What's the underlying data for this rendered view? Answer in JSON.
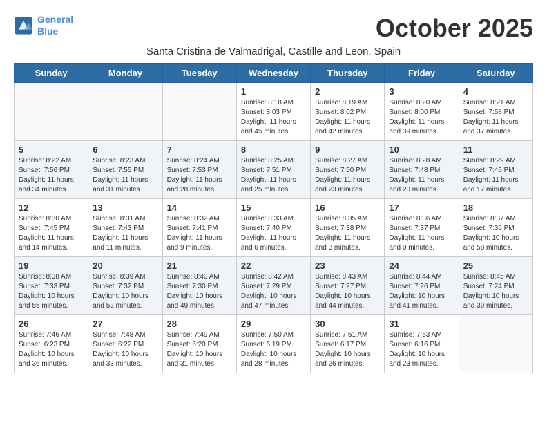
{
  "header": {
    "logo_line1": "General",
    "logo_line2": "Blue",
    "month_title": "October 2025",
    "location": "Santa Cristina de Valmadrigal, Castille and Leon, Spain"
  },
  "weekdays": [
    "Sunday",
    "Monday",
    "Tuesday",
    "Wednesday",
    "Thursday",
    "Friday",
    "Saturday"
  ],
  "weeks": [
    [
      {
        "day": "",
        "info": ""
      },
      {
        "day": "",
        "info": ""
      },
      {
        "day": "",
        "info": ""
      },
      {
        "day": "1",
        "info": "Sunrise: 8:18 AM\nSunset: 8:03 PM\nDaylight: 11 hours\nand 45 minutes."
      },
      {
        "day": "2",
        "info": "Sunrise: 8:19 AM\nSunset: 8:02 PM\nDaylight: 11 hours\nand 42 minutes."
      },
      {
        "day": "3",
        "info": "Sunrise: 8:20 AM\nSunset: 8:00 PM\nDaylight: 11 hours\nand 39 minutes."
      },
      {
        "day": "4",
        "info": "Sunrise: 8:21 AM\nSunset: 7:58 PM\nDaylight: 11 hours\nand 37 minutes."
      }
    ],
    [
      {
        "day": "5",
        "info": "Sunrise: 8:22 AM\nSunset: 7:56 PM\nDaylight: 11 hours\nand 34 minutes."
      },
      {
        "day": "6",
        "info": "Sunrise: 8:23 AM\nSunset: 7:55 PM\nDaylight: 11 hours\nand 31 minutes."
      },
      {
        "day": "7",
        "info": "Sunrise: 8:24 AM\nSunset: 7:53 PM\nDaylight: 11 hours\nand 28 minutes."
      },
      {
        "day": "8",
        "info": "Sunrise: 8:25 AM\nSunset: 7:51 PM\nDaylight: 11 hours\nand 25 minutes."
      },
      {
        "day": "9",
        "info": "Sunrise: 8:27 AM\nSunset: 7:50 PM\nDaylight: 11 hours\nand 23 minutes."
      },
      {
        "day": "10",
        "info": "Sunrise: 8:28 AM\nSunset: 7:48 PM\nDaylight: 11 hours\nand 20 minutes."
      },
      {
        "day": "11",
        "info": "Sunrise: 8:29 AM\nSunset: 7:46 PM\nDaylight: 11 hours\nand 17 minutes."
      }
    ],
    [
      {
        "day": "12",
        "info": "Sunrise: 8:30 AM\nSunset: 7:45 PM\nDaylight: 11 hours\nand 14 minutes."
      },
      {
        "day": "13",
        "info": "Sunrise: 8:31 AM\nSunset: 7:43 PM\nDaylight: 11 hours\nand 11 minutes."
      },
      {
        "day": "14",
        "info": "Sunrise: 8:32 AM\nSunset: 7:41 PM\nDaylight: 11 hours\nand 9 minutes."
      },
      {
        "day": "15",
        "info": "Sunrise: 8:33 AM\nSunset: 7:40 PM\nDaylight: 11 hours\nand 6 minutes."
      },
      {
        "day": "16",
        "info": "Sunrise: 8:35 AM\nSunset: 7:38 PM\nDaylight: 11 hours\nand 3 minutes."
      },
      {
        "day": "17",
        "info": "Sunrise: 8:36 AM\nSunset: 7:37 PM\nDaylight: 11 hours\nand 0 minutes."
      },
      {
        "day": "18",
        "info": "Sunrise: 8:37 AM\nSunset: 7:35 PM\nDaylight: 10 hours\nand 58 minutes."
      }
    ],
    [
      {
        "day": "19",
        "info": "Sunrise: 8:38 AM\nSunset: 7:33 PM\nDaylight: 10 hours\nand 55 minutes."
      },
      {
        "day": "20",
        "info": "Sunrise: 8:39 AM\nSunset: 7:32 PM\nDaylight: 10 hours\nand 52 minutes."
      },
      {
        "day": "21",
        "info": "Sunrise: 8:40 AM\nSunset: 7:30 PM\nDaylight: 10 hours\nand 49 minutes."
      },
      {
        "day": "22",
        "info": "Sunrise: 8:42 AM\nSunset: 7:29 PM\nDaylight: 10 hours\nand 47 minutes."
      },
      {
        "day": "23",
        "info": "Sunrise: 8:43 AM\nSunset: 7:27 PM\nDaylight: 10 hours\nand 44 minutes."
      },
      {
        "day": "24",
        "info": "Sunrise: 8:44 AM\nSunset: 7:26 PM\nDaylight: 10 hours\nand 41 minutes."
      },
      {
        "day": "25",
        "info": "Sunrise: 8:45 AM\nSunset: 7:24 PM\nDaylight: 10 hours\nand 39 minutes."
      }
    ],
    [
      {
        "day": "26",
        "info": "Sunrise: 7:46 AM\nSunset: 6:23 PM\nDaylight: 10 hours\nand 36 minutes."
      },
      {
        "day": "27",
        "info": "Sunrise: 7:48 AM\nSunset: 6:22 PM\nDaylight: 10 hours\nand 33 minutes."
      },
      {
        "day": "28",
        "info": "Sunrise: 7:49 AM\nSunset: 6:20 PM\nDaylight: 10 hours\nand 31 minutes."
      },
      {
        "day": "29",
        "info": "Sunrise: 7:50 AM\nSunset: 6:19 PM\nDaylight: 10 hours\nand 28 minutes."
      },
      {
        "day": "30",
        "info": "Sunrise: 7:51 AM\nSunset: 6:17 PM\nDaylight: 10 hours\nand 26 minutes."
      },
      {
        "day": "31",
        "info": "Sunrise: 7:53 AM\nSunset: 6:16 PM\nDaylight: 10 hours\nand 23 minutes."
      },
      {
        "day": "",
        "info": ""
      }
    ]
  ]
}
